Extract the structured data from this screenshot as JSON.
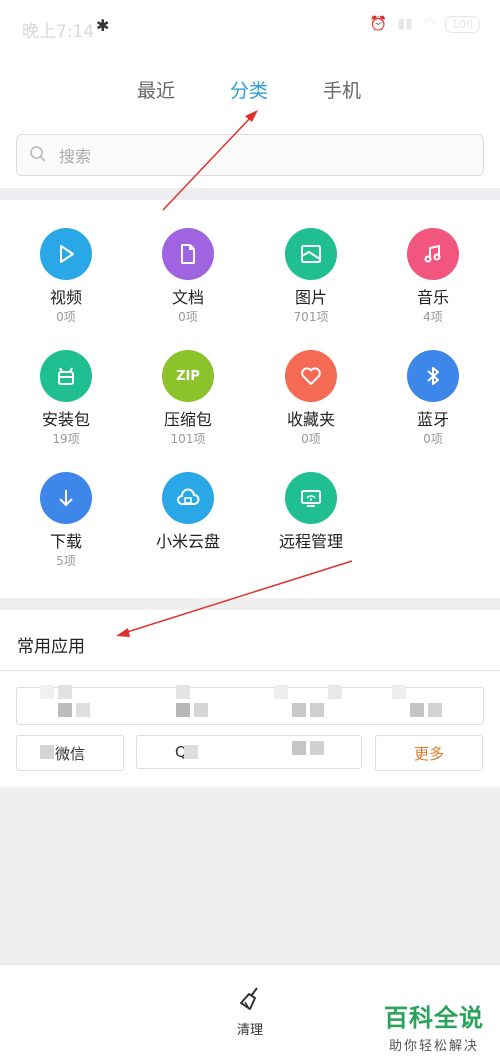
{
  "status": {
    "time": "晚上7:14",
    "battery": "100"
  },
  "tabs": [
    {
      "label": "最近",
      "active": false
    },
    {
      "label": "分类",
      "active": true
    },
    {
      "label": "手机",
      "active": false
    }
  ],
  "search": {
    "placeholder": "搜索"
  },
  "categories": [
    {
      "label": "视频",
      "count": "0项",
      "icon": "play-icon",
      "color": "#2aa7e6"
    },
    {
      "label": "文档",
      "count": "0项",
      "icon": "document-icon",
      "color": "#a064e0"
    },
    {
      "label": "图片",
      "count": "701项",
      "icon": "picture-icon",
      "color": "#1fbf91"
    },
    {
      "label": "音乐",
      "count": "4项",
      "icon": "music-icon",
      "color": "#f2567e"
    },
    {
      "label": "安装包",
      "count": "19项",
      "icon": "android-package-icon",
      "color": "#1fbf91"
    },
    {
      "label": "压缩包",
      "count": "101项",
      "icon": "zip-icon",
      "color": "#8cc22a"
    },
    {
      "label": "收藏夹",
      "count": "0项",
      "icon": "heart-icon",
      "color": "#f56a54"
    },
    {
      "label": "蓝牙",
      "count": "0项",
      "icon": "bluetooth-icon",
      "color": "#3f86ea"
    },
    {
      "label": "下载",
      "count": "5项",
      "icon": "download-icon",
      "color": "#3f86ea"
    },
    {
      "label": "小米云盘",
      "count": "",
      "icon": "cloud-drive-icon",
      "color": "#2aa7e6"
    },
    {
      "label": "远程管理",
      "count": "",
      "icon": "remote-manage-icon",
      "color": "#1fbf91"
    }
  ],
  "zip_text": "ZIP",
  "frequent_apps": {
    "title": "常用应用",
    "buttons": [
      "微信",
      "Q",
      "",
      "更多"
    ]
  },
  "bottom": {
    "clean_label": "清理"
  },
  "watermark": {
    "title": "百科全说",
    "subtitle": "助你轻松解决"
  }
}
